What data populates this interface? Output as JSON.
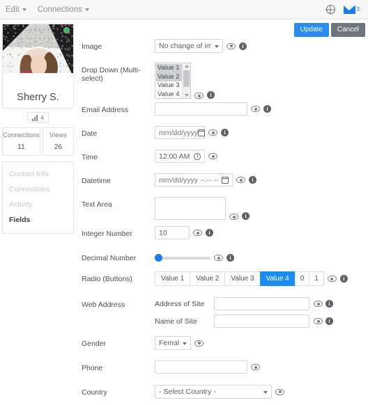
{
  "topbar": {
    "menus": [
      {
        "label": "Edit",
        "name": "menu-edit"
      },
      {
        "label": "Connections",
        "name": "menu-connections"
      }
    ],
    "globe_icon": "globe-icon",
    "mail_icon": "envelope-icon",
    "mail_count": "3"
  },
  "actions": {
    "update_label": "Update",
    "cancel_label": "Cancel"
  },
  "profile": {
    "name": "Sherry S.",
    "online": true,
    "rss_count": "4",
    "stats": [
      {
        "label": "Connections",
        "value": "11"
      },
      {
        "label": "Views",
        "value": "26"
      }
    ],
    "tabs": [
      {
        "label": "Contact Info",
        "active": false
      },
      {
        "label": "Connections",
        "active": false
      },
      {
        "label": "Activity",
        "active": false
      },
      {
        "label": "Fields",
        "active": true
      }
    ]
  },
  "form": {
    "image": {
      "label": "Image",
      "value": "No change of image",
      "options": [
        "No change of image"
      ]
    },
    "dropdown_multi": {
      "label": "Drop Down (Multi-select)",
      "options": [
        {
          "label": "Value 1",
          "selected": true
        },
        {
          "label": "Value 2",
          "selected": true
        },
        {
          "label": "Value 3",
          "selected": false
        },
        {
          "label": "Value 4",
          "selected": false
        }
      ]
    },
    "email": {
      "label": "Email Address",
      "value": "",
      "placeholder": ""
    },
    "date": {
      "label": "Date",
      "placeholder": "mm/dd/yyyy"
    },
    "time": {
      "label": "Time",
      "value": "12:00 AM"
    },
    "datetime": {
      "label": "Datetime",
      "placeholder": "mm/dd/yyyy --:-- --"
    },
    "textarea": {
      "label": "Text Area",
      "value": ""
    },
    "integer": {
      "label": "Integer Number",
      "value": "10"
    },
    "decimal": {
      "label": "Decimal Number",
      "value": "0"
    },
    "radio": {
      "label": "Radio (Buttons)",
      "options": [
        {
          "label": "Value 1",
          "selected": false
        },
        {
          "label": "Value 2",
          "selected": false
        },
        {
          "label": "Value 3",
          "selected": false
        },
        {
          "label": "Value 4",
          "selected": true
        },
        {
          "label": "0",
          "selected": false
        },
        {
          "label": "1",
          "selected": false
        }
      ]
    },
    "web_address": {
      "label": "Web Address",
      "address_label": "Address of Site",
      "address_value": "",
      "name_label": "Name of Site",
      "name_value": ""
    },
    "gender": {
      "label": "Gender",
      "value": "Female",
      "options": [
        "Female"
      ]
    },
    "phone": {
      "label": "Phone",
      "value": ""
    },
    "country": {
      "label": "Country",
      "value": "- Select Country -",
      "options": [
        "- Select Country -"
      ]
    }
  },
  "icons": {
    "eye": "eye-icon",
    "info": "info-icon",
    "calendar": "calendar-icon",
    "clock": "clock-icon"
  },
  "colors": {
    "accent": "#1b8cf3",
    "primary_button": "#2a8cf0",
    "secondary_button": "#6f757c",
    "online": "#2fbf4a"
  }
}
